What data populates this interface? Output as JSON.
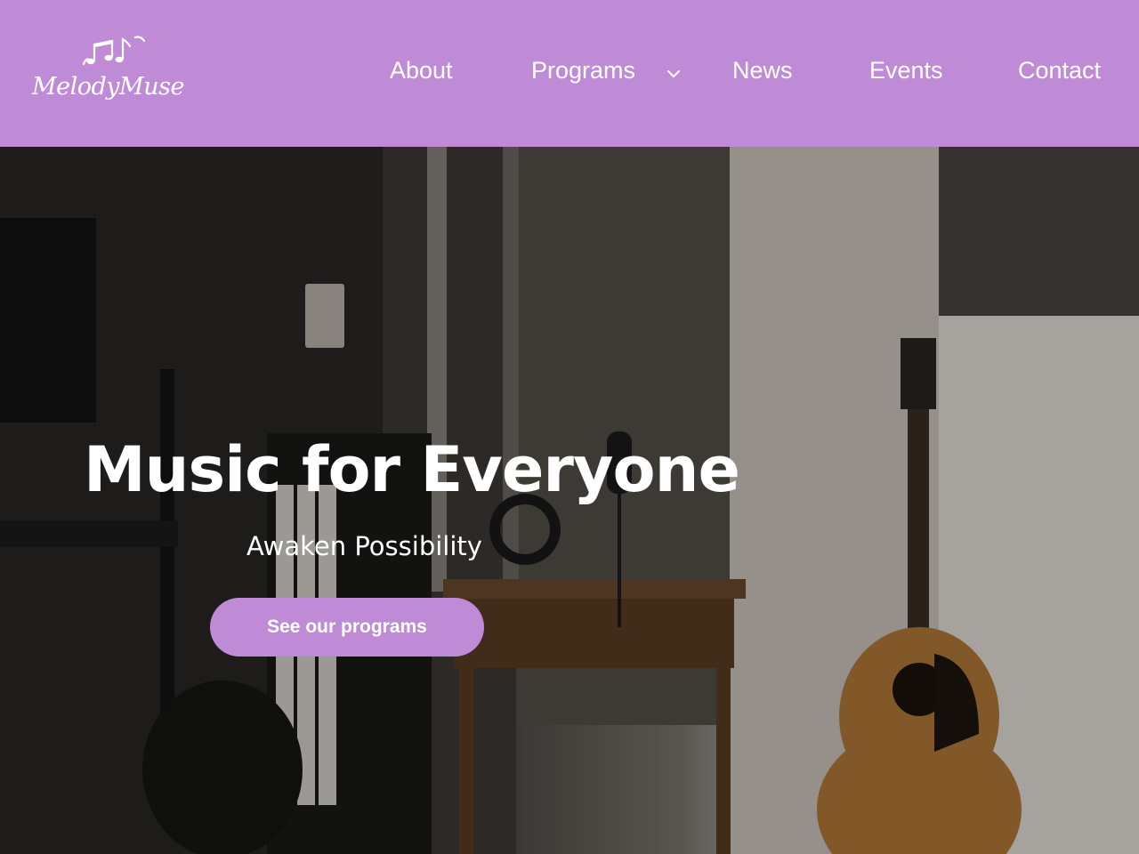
{
  "brand": {
    "name": "MelodyMuse",
    "logo_icon": "music-notes-icon",
    "color": "#c08bd6"
  },
  "nav": {
    "items": [
      {
        "label": "About"
      },
      {
        "label": "Programs",
        "has_dropdown": true
      },
      {
        "label": "News"
      },
      {
        "label": "Events"
      },
      {
        "label": "Contact"
      }
    ]
  },
  "hero": {
    "title": "Music for Everyone",
    "subtitle": "Awaken Possibility",
    "cta_label": "See our programs",
    "background": "music studio with keyboard, bass, microphone, headphones and acoustic guitar"
  }
}
